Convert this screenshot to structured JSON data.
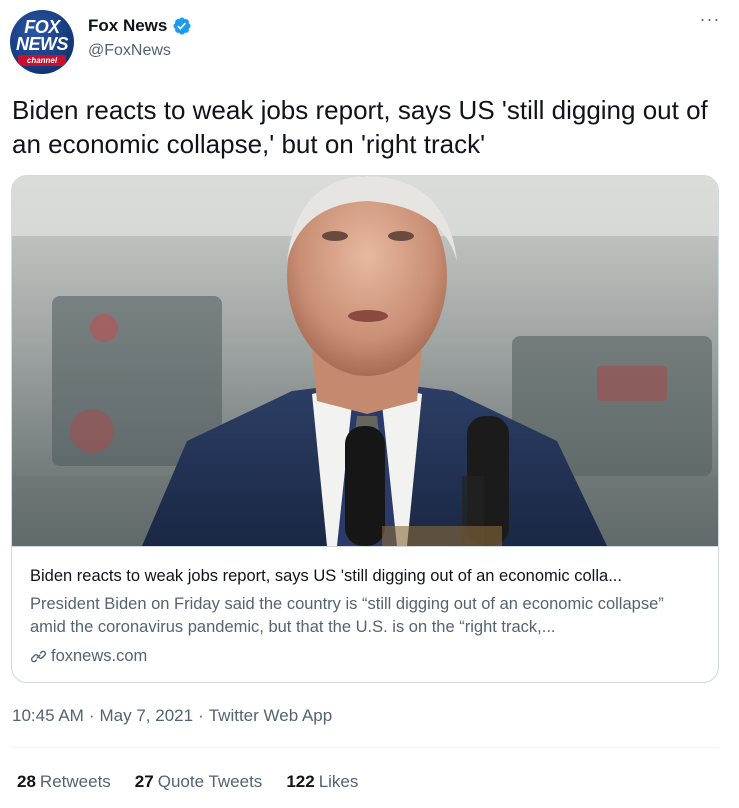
{
  "account": {
    "display_name": "Fox News",
    "handle": "@FoxNews",
    "avatar_text_top": "FOX",
    "avatar_text_mid": "NEWS",
    "avatar_text_bottom": "channel",
    "verified_color": "#1d9bf0"
  },
  "more_label": "···",
  "tweet": {
    "text": "Biden reacts to weak jobs report, says US 'still digging out of an economic collapse,' but on 'right track'"
  },
  "card": {
    "image_alt_icon": "photo-of-speaker-at-microphones",
    "title": "Biden reacts to weak jobs report, says US 'still digging out of an economic colla...",
    "description": "President Biden on Friday said the country is “still digging out of an economic collapse” amid the coronavirus pandemic, but that the U.S. is on the “right track,...",
    "domain": "foxnews.com"
  },
  "meta": {
    "time": "10:45 AM",
    "date": "May 7, 2021",
    "source": "Twitter Web App",
    "separator": "·"
  },
  "stats": {
    "retweets_count": "28",
    "retweets_label": "Retweets",
    "quotes_count": "27",
    "quotes_label": "Quote Tweets",
    "likes_count": "122",
    "likes_label": "Likes"
  },
  "colors": {
    "text_primary": "#0f1419",
    "text_secondary": "#536471",
    "border": "#cfd9de",
    "brand_blue": "#1d9bf0"
  }
}
